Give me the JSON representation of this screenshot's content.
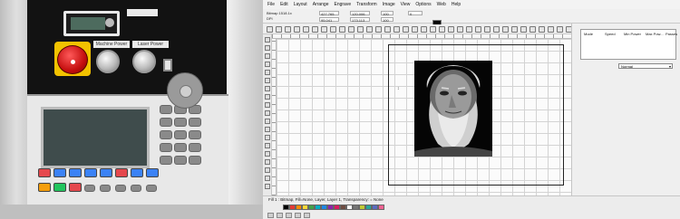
{
  "photo": {
    "panel_labels": [
      "Machine Power",
      "Laser Power"
    ],
    "top_label": "",
    "controller_color_keys": [
      "#e5484d",
      "#3b82f6",
      "#3b82f6",
      "#3b82f6",
      "#3b82f6",
      "#e5484d",
      "#3b82f6",
      "#3b82f6",
      "#f59e0b",
      "#22c55e",
      "#e5484d"
    ]
  },
  "software": {
    "menu": [
      "File",
      "Edit",
      "Layout",
      "Arrange",
      "Engrave",
      "Transform",
      "Image",
      "View",
      "Options",
      "Web",
      "Help"
    ],
    "props": {
      "position_x": "427.765",
      "position_y": "95.041",
      "size_w": "120.006",
      "size_h": "173.113",
      "scale_w": "100",
      "scale_h": "100",
      "angle": "0",
      "object_info": "Bitmap 1518.1x",
      "object_dpi": "DPI"
    },
    "layer_table_headers": [
      "Mode",
      "Speed",
      "Min Power",
      "Max Pow...",
      "Passes"
    ],
    "mode_select": "Normal",
    "status_text": "Fill 1 : Bitmap, Fill=None, Layer, Layer 1, Transparency: = None",
    "palette": [
      "#000000",
      "#e53935",
      "#fb8c00",
      "#fdd835",
      "#43a047",
      "#00acc1",
      "#1e88e5",
      "#8e24aa",
      "#d81b60",
      "#6d4c41",
      "#ffffff",
      "#757575",
      "#c0ca33",
      "#26a69a",
      "#5c6bc0",
      "#f06292"
    ],
    "cursor_mark": "↕"
  }
}
